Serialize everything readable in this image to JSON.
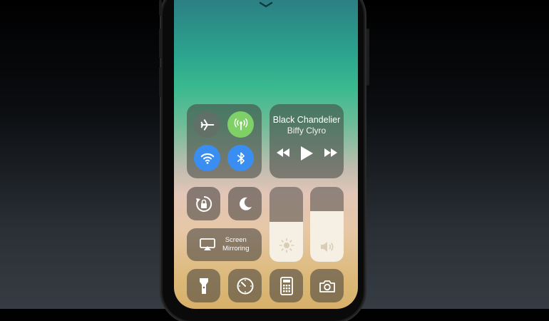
{
  "now_playing": {
    "title": "Black Chandelier",
    "artist": "Biffy Clyro",
    "controls": [
      "previous",
      "play",
      "next"
    ]
  },
  "connectivity": {
    "airplane_mode": false,
    "cellular_data": true,
    "wifi": true,
    "bluetooth": true
  },
  "screen_mirroring": {
    "line1": "Screen",
    "line2": "Mirroring"
  },
  "brightness_level": 0.53,
  "volume_level": 0.68,
  "colors": {
    "cellular_green": "#7ed067",
    "wifi_blue": "#3a8ef1",
    "bluetooth_blue": "#3a8ef1",
    "inactive_gray": "rgba(100,105,100,0.85)"
  },
  "icons": [
    "chevron-down-icon",
    "airplane-icon",
    "cellular-icon",
    "wifi-icon",
    "bluetooth-icon",
    "rewind-icon",
    "play-icon",
    "fast-forward-icon",
    "rotation-lock-icon",
    "moon-icon",
    "screen-mirroring-icon",
    "brightness-icon",
    "volume-icon",
    "flashlight-icon",
    "timer-icon",
    "calculator-icon",
    "camera-icon"
  ]
}
